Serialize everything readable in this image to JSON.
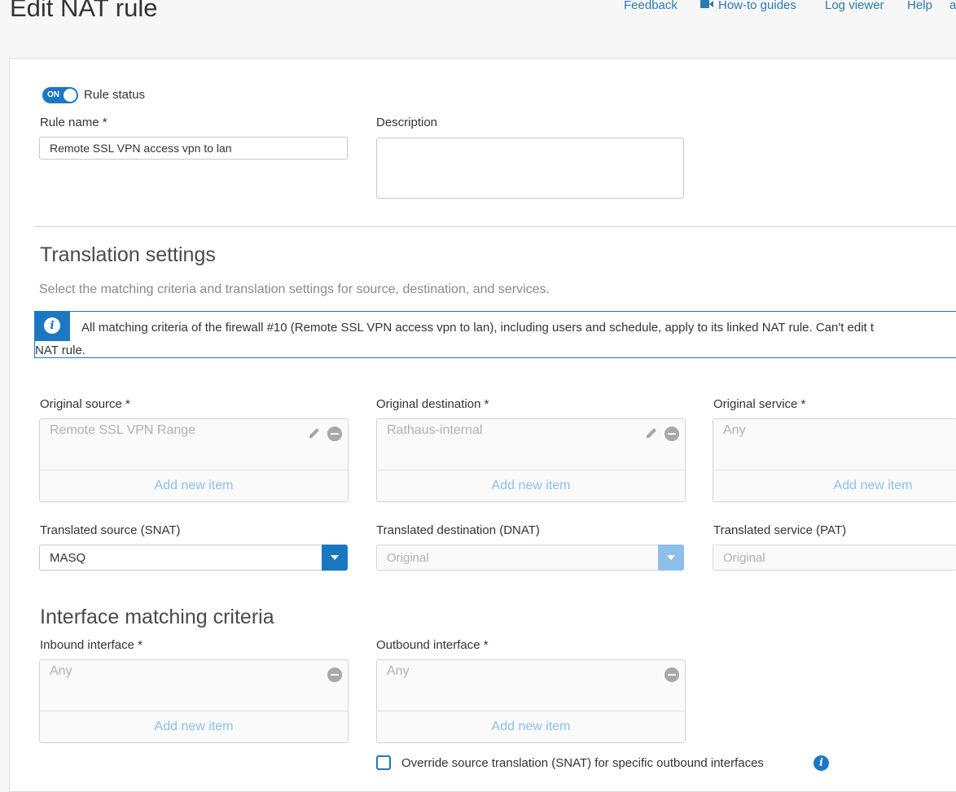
{
  "page": {
    "title": "Edit NAT rule"
  },
  "top_links": {
    "feedback": "Feedback",
    "how_to": "How-to guides",
    "log_viewer": "Log viewer",
    "help": "Help",
    "cut_off": "a"
  },
  "rule_status": {
    "toggle_text": "ON",
    "label": "Rule status",
    "enabled": true
  },
  "rule_name": {
    "label": "Rule name *",
    "value": "Remote SSL VPN access vpn to lan"
  },
  "description": {
    "label": "Description",
    "value": ""
  },
  "translation": {
    "title": "Translation settings",
    "subtitle": "Select the matching criteria and translation settings for source, destination, and services.",
    "info_line1": "All matching criteria of the firewall #10 (Remote SSL VPN access vpn to lan), including users and schedule, apply to its linked NAT rule. Can't edit t",
    "info_line2": "NAT rule."
  },
  "original": {
    "source": {
      "label": "Original source *",
      "item": "Remote SSL VPN Range",
      "add": "Add new item"
    },
    "destination": {
      "label": "Original destination *",
      "item": "Rathaus-internal",
      "add": "Add new item"
    },
    "service": {
      "label": "Original service *",
      "item": "Any",
      "add": "Add new item"
    }
  },
  "translated": {
    "source": {
      "label": "Translated source (SNAT)",
      "value": "MASQ"
    },
    "destination": {
      "label": "Translated destination (DNAT)",
      "value": "Original"
    },
    "service": {
      "label": "Translated service (PAT)",
      "value": "Original"
    }
  },
  "interface": {
    "title": "Interface matching criteria",
    "inbound": {
      "label": "Inbound interface *",
      "item": "Any",
      "add": "Add new item"
    },
    "outbound": {
      "label": "Outbound interface *",
      "item": "Any",
      "add": "Add new item"
    },
    "override_label": "Override source translation (SNAT) for specific outbound interfaces",
    "override_checked": false
  },
  "colors": {
    "accent": "#1c77c3",
    "link": "#2a7ab0",
    "disabled_accent": "#8cc0e8"
  }
}
